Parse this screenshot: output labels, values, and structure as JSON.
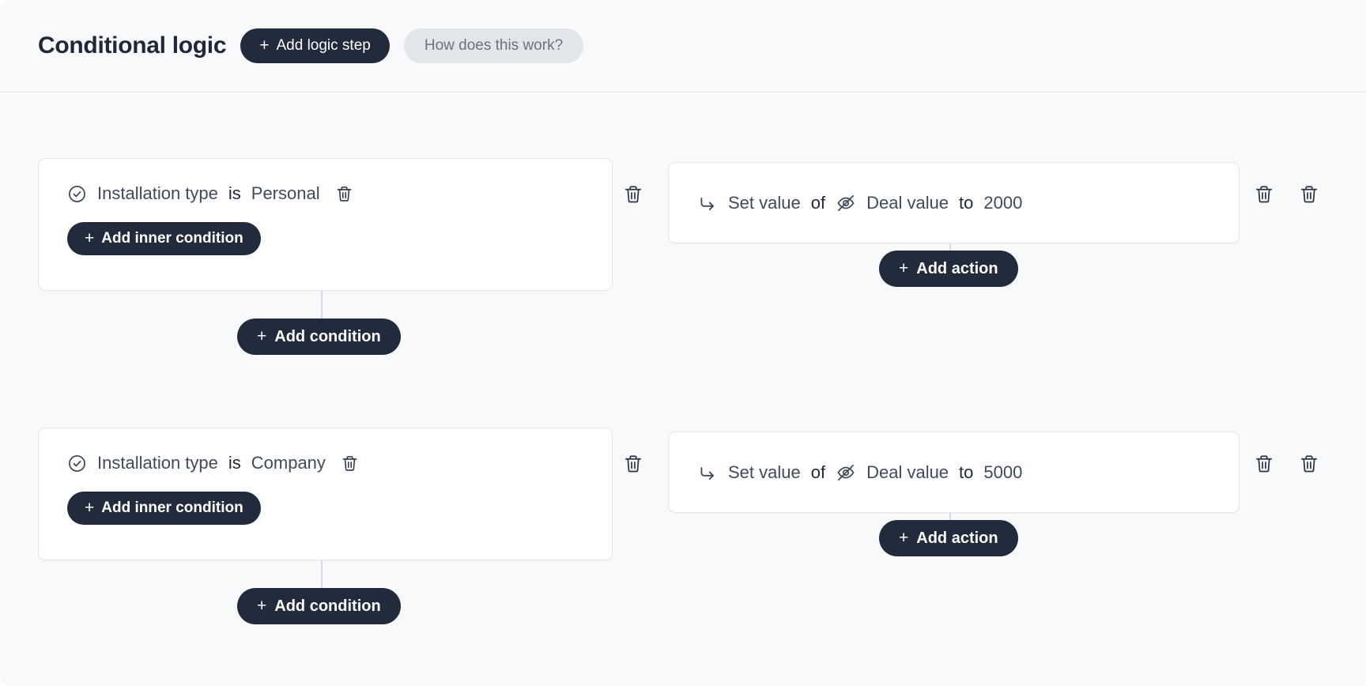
{
  "header": {
    "title": "Conditional logic",
    "add_logic_step_label": "Add logic step",
    "how_does_this_work_label": "How does this work?",
    "plus_glyph": "+"
  },
  "icons": {
    "check_circle": "check-circle-icon",
    "trash": "trash-icon",
    "eye_off": "eye-off-icon",
    "corner_down_right": "corner-down-right-icon"
  },
  "colors": {
    "page_background": "#f8f9fb",
    "card_background": "#ffffff",
    "card_border": "#e4e7ec",
    "dark_pill": "#222b3c",
    "ghost_pill": "#e2e5ea",
    "primary_text": "#1f2738",
    "secondary_text": "#3f4a5c",
    "muted_text": "#6b7280",
    "connector": "#d7dbe2"
  },
  "labels": {
    "add_condition": "Add condition",
    "add_inner_condition": "Add inner condition",
    "add_action": "Add action"
  },
  "logic_steps": [
    {
      "condition": {
        "field": "Installation type",
        "operator": "is",
        "value": "Personal"
      },
      "action": {
        "verb": "Set value",
        "of": "of",
        "target": "Deal value",
        "to": "to",
        "value": "2000"
      }
    },
    {
      "condition": {
        "field": "Installation type",
        "operator": "is",
        "value": "Company"
      },
      "action": {
        "verb": "Set value",
        "of": "of",
        "target": "Deal value",
        "to": "to",
        "value": "5000"
      }
    }
  ]
}
